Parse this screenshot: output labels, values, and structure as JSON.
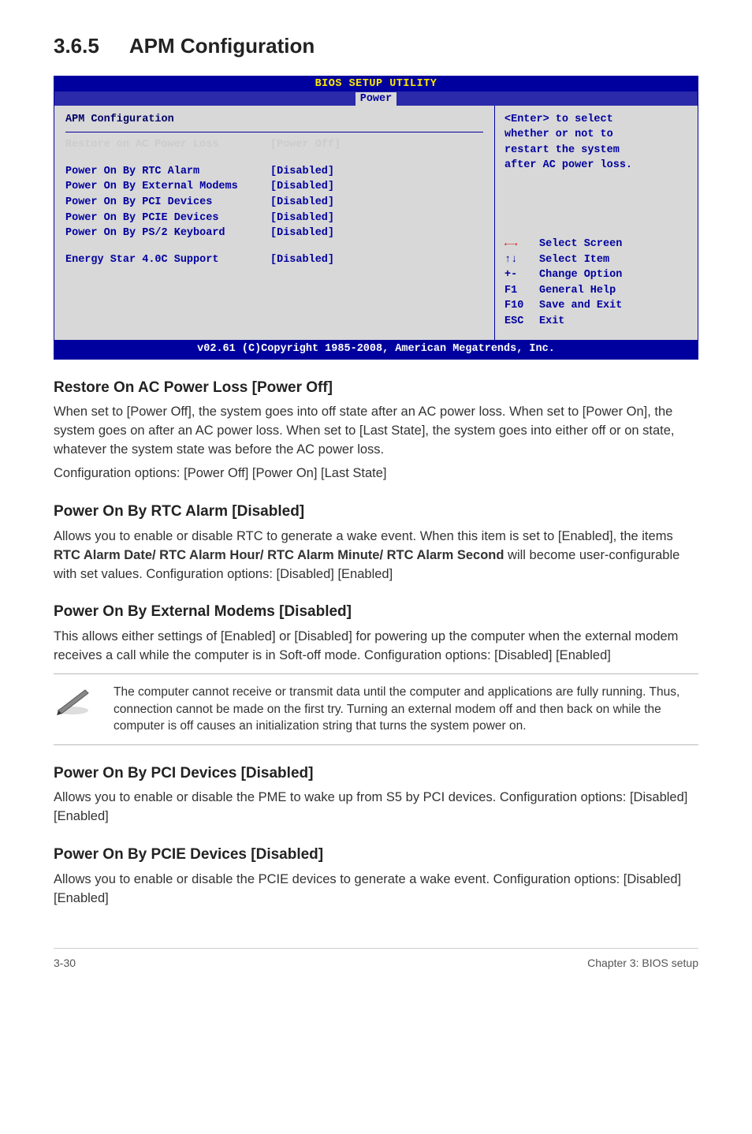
{
  "section": {
    "number": "3.6.5",
    "title": "APM Configuration"
  },
  "bios": {
    "top_title": "BIOS SETUP UTILITY",
    "tab": "Power",
    "heading": "APM Configuration",
    "current": {
      "label": "Restore on AC Power Loss",
      "value": "[Power Off]"
    },
    "rows": [
      {
        "label": "Power On By RTC Alarm",
        "value": "[Disabled]"
      },
      {
        "label": "Power On By External Modems",
        "value": "[Disabled]"
      },
      {
        "label": "Power On By PCI Devices",
        "value": "[Disabled]"
      },
      {
        "label": "Power On By PCIE Devices",
        "value": "[Disabled]"
      },
      {
        "label": "Power On By PS/2 Keyboard",
        "value": "[Disabled]"
      }
    ],
    "extra": {
      "label": "Energy Star 4.0C Support",
      "value": "[Disabled]"
    },
    "help_text_l1": "<Enter> to select",
    "help_text_l2": "whether or not to",
    "help_text_l3": "restart the system",
    "help_text_l4": "after AC power loss.",
    "nav": [
      {
        "key": "←→",
        "text": "Select Screen",
        "arrow": true
      },
      {
        "key": "↑↓",
        "text": "Select Item"
      },
      {
        "key": "+-",
        "text": " Change Option"
      },
      {
        "key": "F1",
        "text": "General Help"
      },
      {
        "key": "F10",
        "text": "Save and Exit"
      },
      {
        "key": "ESC",
        "text": "Exit"
      }
    ],
    "copyright": "v02.61 (C)Copyright 1985-2008, American Megatrends, Inc."
  },
  "subsections": [
    {
      "title": "Restore On AC Power Loss [Power Off]",
      "paras": [
        "When set to [Power Off], the system goes into off state after an AC power loss. When set to [Power On], the system goes on after an AC power loss. When set to [Last State], the system goes into either off or on state, whatever the system state was before the AC power loss.",
        "Configuration options: [Power Off] [Power On] [Last State]"
      ]
    },
    {
      "title": "Power On By RTC Alarm [Disabled]",
      "paras_html": [
        "Allows you to enable or disable RTC to generate a wake event. When this item is set to [Enabled], the items <b>RTC Alarm Date/ RTC Alarm Hour/ RTC Alarm Minute/ RTC Alarm Second</b> will become user-configurable with set values. Configuration options: [Disabled] [Enabled]"
      ]
    },
    {
      "title": "Power On By External Modems [Disabled]",
      "paras": [
        "This allows either settings of [Enabled] or [Disabled] for powering up the computer when the external modem receives a call while the computer is in Soft-off mode. Configuration options: [Disabled] [Enabled]"
      ]
    }
  ],
  "note": "The computer cannot receive or transmit data until the computer and applications are fully running. Thus, connection cannot be made on the first try. Turning an external modem off and then back on while the computer is off causes an initialization string that turns the system power on.",
  "subsections2": [
    {
      "title": "Power On By PCI Devices [Disabled]",
      "paras": [
        "Allows you to enable or disable the PME to wake up from S5 by PCI devices. Configuration options: [Disabled] [Enabled]"
      ]
    },
    {
      "title": "Power On By PCIE Devices [Disabled]",
      "paras": [
        "Allows you to enable or disable the PCIE devices to generate a wake event. Configuration options: [Disabled] [Enabled]"
      ]
    }
  ],
  "footer": {
    "left": "3-30",
    "right": "Chapter 3: BIOS setup"
  }
}
